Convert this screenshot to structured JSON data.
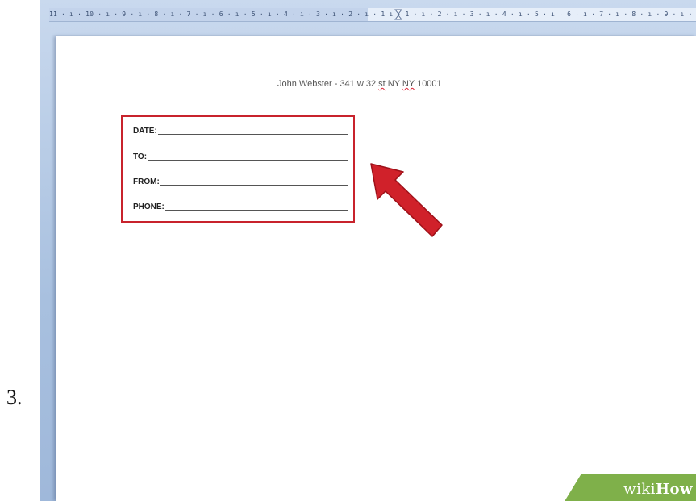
{
  "step": {
    "number": "3."
  },
  "ruler": {
    "marks": "11 · ı · 10 · ı · 9 · ı · 8 · ı · 7 · ı · 6 · ı · 5 · ı · 4 · ı · 3 · ı · 2 · ı · 1      ı · 1 · ı · 2 · ı · 3 · ı · 4 · ı · 5 · ı · 6 · ı · 7 · ı · 8 · ı · 9 · ı ·"
  },
  "document": {
    "sender_line_parts": [
      "John Webster - 341 w 32 ",
      "st",
      " NY ",
      "NY",
      " 10001"
    ]
  },
  "form": {
    "fields": [
      {
        "label": "DATE:"
      },
      {
        "label": "TO:"
      },
      {
        "label": "FROM:"
      },
      {
        "label": "PHONE:"
      }
    ],
    "highlight_color": "#c8232c"
  },
  "watermark": {
    "wiki": "wiki",
    "how": "How"
  },
  "colors": {
    "workspace": "#b4c7e0",
    "arrow": "#d0212a",
    "watermark_bg": "#7fb04a"
  }
}
